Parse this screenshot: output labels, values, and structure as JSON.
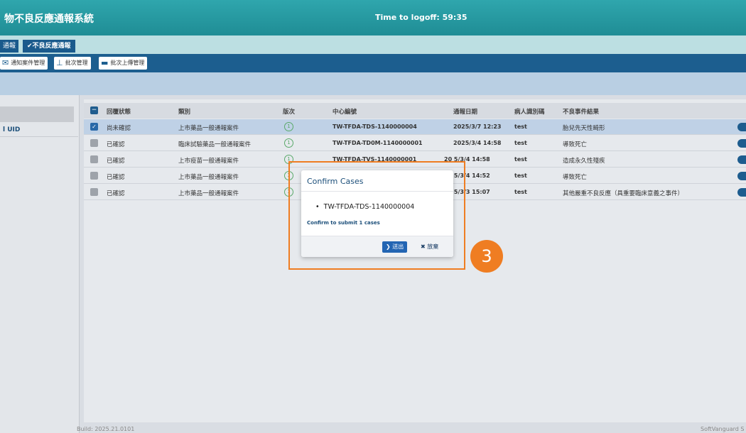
{
  "header": {
    "app_title": "物不良反應通報系統",
    "logoff_timer": "Time to logoff: 59:35"
  },
  "tabs": [
    {
      "label": "通報"
    },
    {
      "label": "✔不良反應通報"
    }
  ],
  "toolbar": {
    "items": [
      {
        "label": "通知案件管理"
      },
      {
        "label": "批次管理"
      },
      {
        "label": "批次上傳管理"
      }
    ]
  },
  "left_panel": {
    "uid_label": "l UID"
  },
  "grid": {
    "columns": [
      "回覆狀態",
      "類別",
      "版次",
      "中心編號",
      "通報日期",
      "病人識別碼",
      "不良事件結果"
    ],
    "rows": [
      {
        "status": "尚未確認",
        "category": "上市藥品一般通報案件",
        "version": "1",
        "case_no": "TW-TFDA-TDS-1140000004",
        "date": "2025/3/7 12:23",
        "patient": "test",
        "result": "胎兒先天性畸形",
        "selected": true
      },
      {
        "status": "已確認",
        "category": "臨床試驗藥品一般通報案件",
        "version": "1",
        "case_no": "TW-TFDA-TD0M-1140000001",
        "date": "2025/3/4 14:58",
        "patient": "test",
        "result": "導致死亡",
        "selected": false
      },
      {
        "status": "已確認",
        "category": "上市疫苗一般通報案件",
        "version": "1",
        "case_no": "TW-TFDA-TVS-1140000001",
        "date": "20 5/3/4 14:58",
        "patient": "test",
        "result": "造成永久性殘疾",
        "selected": false
      },
      {
        "status": "已確認",
        "category": "上市藥品一般通報案件",
        "version": "1",
        "case_no": "",
        "date": "20 5/3/4 14:52",
        "patient": "test",
        "result": "導致死亡",
        "selected": false
      },
      {
        "status": "已確認",
        "category": "上市藥品一般通報案件",
        "version": "1",
        "case_no": "",
        "date": "20 5/3/3 15:07",
        "patient": "test",
        "result": "其他嚴重不良反應（具重要臨床意義之事件）",
        "selected": false
      }
    ]
  },
  "dialog": {
    "title": "Confirm Cases",
    "case_item": "TW-TFDA-TDS-1140000004",
    "message": "Confirm to submit 1 cases",
    "submit_label": "送出",
    "cancel_label": "放棄"
  },
  "annotation": {
    "step_number": "3"
  },
  "footer": {
    "build": "Build: 2025.21.0101",
    "company": "SoftVanguard S"
  },
  "colors": {
    "header": "#1f8d95",
    "toolbar": "#1c5e8f",
    "highlight": "#ef7d22",
    "submit_button": "#2365b3"
  }
}
